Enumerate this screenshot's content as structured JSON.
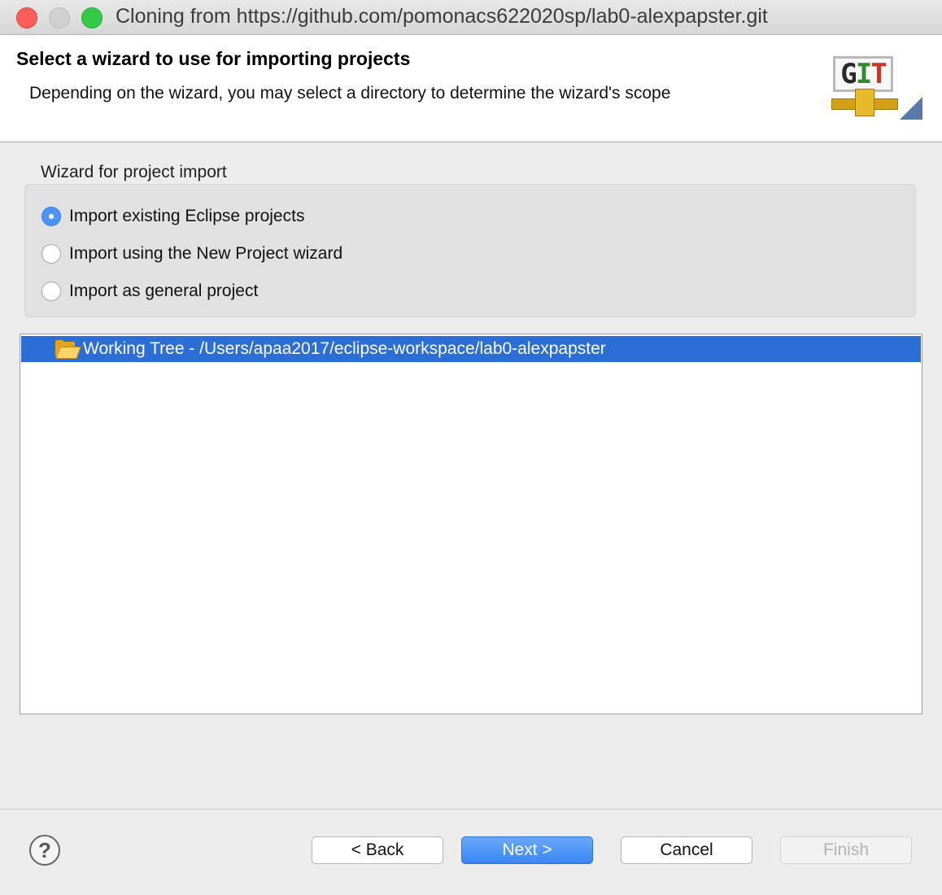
{
  "window": {
    "title": "Cloning from https://github.com/pomonacs622020sp/lab0-alexpapster.git"
  },
  "header": {
    "title": "Select a wizard to use for importing projects",
    "description": "Depending on the wizard, you may select a directory to determine the wizard's scope",
    "logo_text": "GIT"
  },
  "wizard_group": {
    "label": "Wizard for project import",
    "options": [
      {
        "label": "Import existing Eclipse projects",
        "checked": true
      },
      {
        "label": "Import using the New Project wizard",
        "checked": false
      },
      {
        "label": "Import as general project",
        "checked": false
      }
    ]
  },
  "tree": {
    "items": [
      {
        "label": "Working Tree - /Users/apaa2017/eclipse-workspace/lab0-alexpapster",
        "selected": true,
        "icon": "folder-open-icon"
      }
    ]
  },
  "footer": {
    "help_icon": "?",
    "back_label": "< Back",
    "next_label": "Next >",
    "cancel_label": "Cancel",
    "finish_label": "Finish",
    "finish_enabled": false
  },
  "colors": {
    "selection": "#2b6fd6",
    "primary_button": "#3a86f5",
    "close": "#fc5f57",
    "maximize": "#35c94a"
  }
}
